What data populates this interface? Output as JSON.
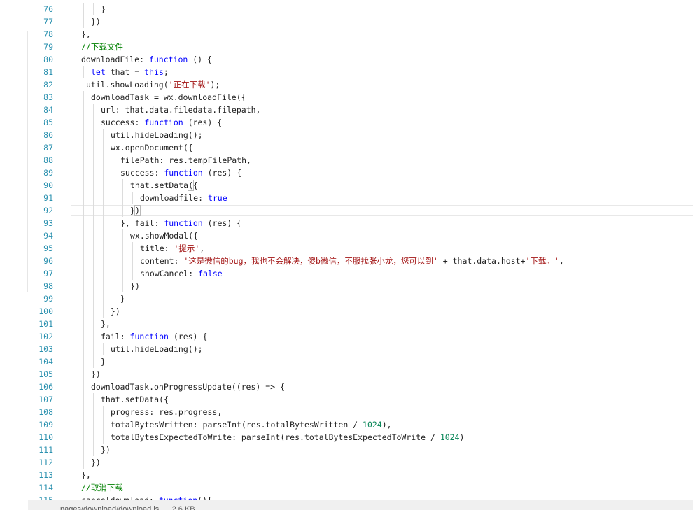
{
  "editor": {
    "lines": [
      {
        "n": "76",
        "indent": 3,
        "tokens": [
          {
            "t": "}",
            "c": "plain"
          }
        ]
      },
      {
        "n": "77",
        "indent": 2,
        "tokens": [
          {
            "t": "})",
            "c": "plain"
          }
        ]
      },
      {
        "n": "78",
        "indent": 1,
        "tokens": [
          {
            "t": "},",
            "c": "plain"
          }
        ]
      },
      {
        "n": "79",
        "indent": 1,
        "tokens": [
          {
            "t": "//下载文件",
            "c": "com"
          }
        ]
      },
      {
        "n": "80",
        "indent": 1,
        "tokens": [
          {
            "t": "downloadFile: ",
            "c": "plain"
          },
          {
            "t": "function",
            "c": "kw"
          },
          {
            "t": " () {",
            "c": "plain"
          }
        ]
      },
      {
        "n": "81",
        "indent": 2,
        "tokens": [
          {
            "t": "let",
            "c": "kw"
          },
          {
            "t": " that = ",
            "c": "plain"
          },
          {
            "t": "this",
            "c": "kw"
          },
          {
            "t": ";",
            "c": "plain"
          }
        ]
      },
      {
        "n": "82",
        "indent": 1,
        "pad": " ",
        "tokens": [
          {
            "t": "util.showLoading(",
            "c": "plain"
          },
          {
            "t": "'正在下载'",
            "c": "str"
          },
          {
            "t": ");",
            "c": "plain"
          }
        ]
      },
      {
        "n": "83",
        "indent": 2,
        "tokens": [
          {
            "t": "downloadTask = wx.downloadFile({",
            "c": "plain"
          }
        ]
      },
      {
        "n": "84",
        "indent": 3,
        "tokens": [
          {
            "t": "url: that.data.filedata.filepath,",
            "c": "plain"
          }
        ]
      },
      {
        "n": "85",
        "indent": 3,
        "tokens": [
          {
            "t": "success: ",
            "c": "plain"
          },
          {
            "t": "function",
            "c": "kw"
          },
          {
            "t": " (res) {",
            "c": "plain"
          }
        ]
      },
      {
        "n": "86",
        "indent": 4,
        "tokens": [
          {
            "t": "util.hideLoading();",
            "c": "plain"
          }
        ]
      },
      {
        "n": "87",
        "indent": 4,
        "tokens": [
          {
            "t": "wx.openDocument({",
            "c": "plain"
          }
        ]
      },
      {
        "n": "88",
        "indent": 5,
        "tokens": [
          {
            "t": "filePath: res.tempFilePath,",
            "c": "plain"
          }
        ]
      },
      {
        "n": "89",
        "indent": 5,
        "tokens": [
          {
            "t": "success: ",
            "c": "plain"
          },
          {
            "t": "function",
            "c": "kw"
          },
          {
            "t": " (res) {",
            "c": "plain"
          }
        ]
      },
      {
        "n": "90",
        "indent": 6,
        "tokens": [
          {
            "t": "that.setData",
            "c": "plain"
          },
          {
            "t": "(",
            "c": "plain",
            "hl": true
          },
          {
            "t": "{",
            "c": "plain"
          }
        ]
      },
      {
        "n": "91",
        "indent": 7,
        "tokens": [
          {
            "t": "downloadfile: ",
            "c": "plain"
          },
          {
            "t": "true",
            "c": "kw"
          }
        ]
      },
      {
        "n": "92",
        "indent": 6,
        "current": true,
        "tokens": [
          {
            "t": "}",
            "c": "plain"
          },
          {
            "t": ")",
            "c": "plain",
            "hl": true
          }
        ]
      },
      {
        "n": "93",
        "indent": 5,
        "tokens": [
          {
            "t": "}, fail: ",
            "c": "plain"
          },
          {
            "t": "function",
            "c": "kw"
          },
          {
            "t": " (res) {",
            "c": "plain"
          }
        ]
      },
      {
        "n": "94",
        "indent": 6,
        "tokens": [
          {
            "t": "wx.showModal({",
            "c": "plain"
          }
        ]
      },
      {
        "n": "95",
        "indent": 7,
        "tokens": [
          {
            "t": "title: ",
            "c": "plain"
          },
          {
            "t": "'提示'",
            "c": "str"
          },
          {
            "t": ",",
            "c": "plain"
          }
        ]
      },
      {
        "n": "96",
        "indent": 7,
        "tokens": [
          {
            "t": "content: ",
            "c": "plain"
          },
          {
            "t": "'这是微信的bug，我也不会解决，傻b微信，不服找张小龙，您可以到'",
            "c": "str"
          },
          {
            "t": " + that.data.host+",
            "c": "plain"
          },
          {
            "t": "'下载。'",
            "c": "str"
          },
          {
            "t": ",",
            "c": "plain"
          }
        ]
      },
      {
        "n": "97",
        "indent": 7,
        "tokens": [
          {
            "t": "showCancel: ",
            "c": "plain"
          },
          {
            "t": "false",
            "c": "kw"
          }
        ]
      },
      {
        "n": "98",
        "indent": 6,
        "tokens": [
          {
            "t": "})",
            "c": "plain"
          }
        ]
      },
      {
        "n": "99",
        "indent": 5,
        "tokens": [
          {
            "t": "}",
            "c": "plain"
          }
        ]
      },
      {
        "n": "100",
        "indent": 4,
        "tokens": [
          {
            "t": "})",
            "c": "plain"
          }
        ]
      },
      {
        "n": "101",
        "indent": 3,
        "tokens": [
          {
            "t": "},",
            "c": "plain"
          }
        ]
      },
      {
        "n": "102",
        "indent": 3,
        "tokens": [
          {
            "t": "fail: ",
            "c": "plain"
          },
          {
            "t": "function",
            "c": "kw"
          },
          {
            "t": " (res) {",
            "c": "plain"
          }
        ]
      },
      {
        "n": "103",
        "indent": 4,
        "tokens": [
          {
            "t": "util.hideLoading();",
            "c": "plain"
          }
        ]
      },
      {
        "n": "104",
        "indent": 3,
        "tokens": [
          {
            "t": "}",
            "c": "plain"
          }
        ]
      },
      {
        "n": "105",
        "indent": 2,
        "tokens": [
          {
            "t": "})",
            "c": "plain"
          }
        ]
      },
      {
        "n": "106",
        "indent": 2,
        "tokens": [
          {
            "t": "downloadTask.onProgressUpdate((res) => {",
            "c": "plain"
          }
        ]
      },
      {
        "n": "107",
        "indent": 3,
        "tokens": [
          {
            "t": "that.setData({",
            "c": "plain"
          }
        ]
      },
      {
        "n": "108",
        "indent": 4,
        "tokens": [
          {
            "t": "progress: res.progress,",
            "c": "plain"
          }
        ]
      },
      {
        "n": "109",
        "indent": 4,
        "tokens": [
          {
            "t": "totalBytesWritten: parseInt(res.totalBytesWritten / ",
            "c": "plain"
          },
          {
            "t": "1024",
            "c": "num"
          },
          {
            "t": "),",
            "c": "plain"
          }
        ]
      },
      {
        "n": "110",
        "indent": 4,
        "tokens": [
          {
            "t": "totalBytesExpectedToWrite: parseInt(res.totalBytesExpectedToWrite / ",
            "c": "plain"
          },
          {
            "t": "1024",
            "c": "num"
          },
          {
            "t": ")",
            "c": "plain"
          }
        ]
      },
      {
        "n": "111",
        "indent": 3,
        "tokens": [
          {
            "t": "})",
            "c": "plain"
          }
        ]
      },
      {
        "n": "112",
        "indent": 2,
        "tokens": [
          {
            "t": "})",
            "c": "plain"
          }
        ]
      },
      {
        "n": "113",
        "indent": 1,
        "tokens": [
          {
            "t": "},",
            "c": "plain"
          }
        ]
      },
      {
        "n": "114",
        "indent": 1,
        "tokens": [
          {
            "t": "//取消下载",
            "c": "com"
          }
        ]
      },
      {
        "n": "115",
        "indent": 1,
        "tokens": [
          {
            "t": "canceldownload: ",
            "c": "plain"
          },
          {
            "t": "function",
            "c": "kw"
          },
          {
            "t": "(){",
            "c": "plain"
          }
        ]
      }
    ]
  },
  "status_bar": {
    "text": "pages/download/download.js      2.6 KB"
  },
  "colors": {
    "keyword": "#0000ff",
    "string": "#a31515",
    "comment": "#008000",
    "number": "#098658",
    "line_number": "#2b91af"
  }
}
